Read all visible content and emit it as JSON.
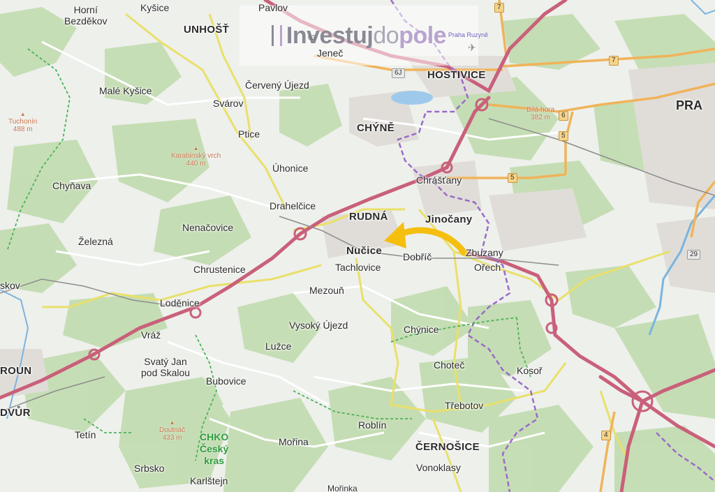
{
  "logo": {
    "part1": "Investuj",
    "part2": "do",
    "part3": "pole"
  },
  "places": {
    "horni_bezdekov": [
      "Horní",
      "Bezděkov"
    ],
    "kysice": "Kyšice",
    "unhost": "UNHOŠŤ",
    "pavlov": "Pavlov",
    "jenec": "Jeneč",
    "hostivice": "HOSTIVICE",
    "praha": "PRA",
    "male_kysice": "Malé Kyšice",
    "cerveny_ujezd": "Červený Újezd",
    "svarov": "Svárov",
    "ptice": "Ptice",
    "chyne": "CHÝNĚ",
    "uhonice": "Úhonice",
    "chynava": "Chyňava",
    "chrastany": "Chrášťany",
    "drahelcice": "Drahelčice",
    "rudna": "RUDNÁ",
    "jinocany": "Jinočany",
    "nenacovice": "Nenačovice",
    "zelezna": "Železná",
    "nucice": "Nučice",
    "dobric": "Dobříč",
    "zbuzany": "Zbuzany",
    "tachlovice": "Tachlovice",
    "orech": "Ořech",
    "chrustenice": "Chrustenice",
    "skov": "skov",
    "mezoun": "Mezouň",
    "lodenice": "Loděnice",
    "vysoky_ujezd": "Vysoký Újezd",
    "chynice": "Chýnice",
    "vraz": "Vráž",
    "luzce": "Lužce",
    "choteč": "Choteč",
    "kosor": "Kosoř",
    "roun": "ROUN",
    "svaty_jan": [
      "Svatý Jan",
      "pod Skalou"
    ],
    "bubovice": "Bubovice",
    "trebotov": "Třebotov",
    "dvur": "DVŮR",
    "roblin": "Roblín",
    "tetin": "Tetín",
    "morina": "Mořina",
    "cernosice": "ČERNOŠICE",
    "srbsko": "Srbsko",
    "vonoklasy": "Vonoklasy",
    "karlstejn": "Karlštejn",
    "morinka": "Mořinka"
  },
  "peaks": {
    "tuchonin": [
      "Tuchonín",
      "488 m"
    ],
    "karabinsky": [
      "Karabinský vrch",
      "440 m"
    ],
    "bilahora": [
      "Bílá hora",
      "382 m"
    ],
    "doutnac": [
      "Doutnáč",
      "433 m"
    ]
  },
  "airport_label": "Praha Ruzyně",
  "chko": [
    "CHKO",
    "Český",
    "kras"
  ],
  "road_numbers": {
    "r7_top": "7",
    "r7_right": "7",
    "r6j": "6J",
    "r6": "6",
    "r5_a": "5",
    "r5_b": "5",
    "r29": "29",
    "r4": "4",
    "r63": "63"
  },
  "colors": {
    "motorway": "#c9607a",
    "main_road": "#e9b45a",
    "secondary_road": "#efe07a",
    "forest": "#b9d7a8",
    "water": "#7ab4e0",
    "border": "#9a6bc8",
    "arrow": "#f5bf10",
    "trail": "#4ab35a"
  }
}
